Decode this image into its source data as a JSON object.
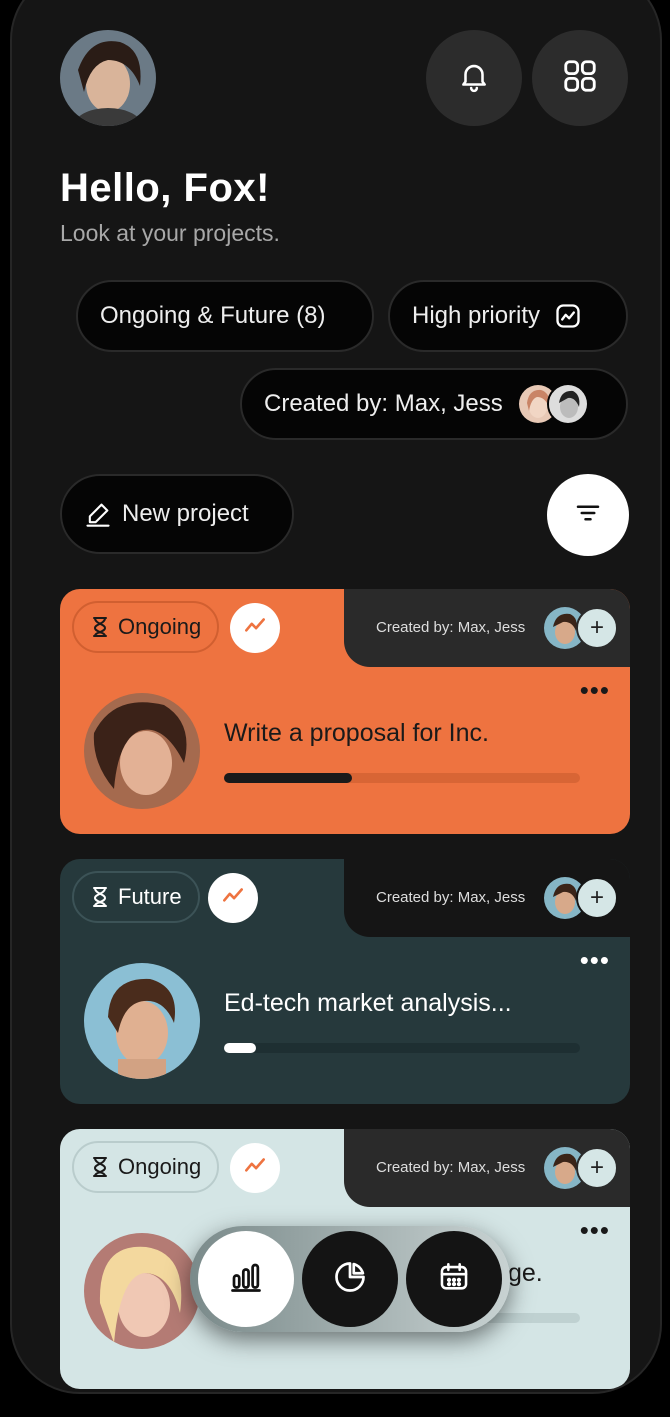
{
  "header": {
    "greeting": "Hello, Fox!",
    "subtitle": "Look at your projects.",
    "notification_icon": "bell-icon",
    "apps_icon": "grid-icon"
  },
  "filters": {
    "ongoing_future": "Ongoing & Future (8)",
    "high_priority": "High priority",
    "created_by": "Created by: Max, Jess"
  },
  "actions": {
    "new_project": "New project",
    "filter_icon": "filter-icon"
  },
  "cards": [
    {
      "status": "Ongoing",
      "created_by": "Created by: Max, Jess",
      "title": "Write a proposal for Inc.",
      "progress": 0.36,
      "bg": "#EE7340",
      "track": "#D86535",
      "fill": "#1A1A1A",
      "text_color": "#1A1A1A"
    },
    {
      "status": "Future",
      "created_by": "Created by: Max, Jess",
      "title": "Ed-tech market analysis...",
      "progress": 0.09,
      "bg": "#26393C",
      "track": "#1E2F32",
      "fill": "#FFFFFF",
      "text_color": "#FFFFFF"
    },
    {
      "status": "Ongoing",
      "created_by": "Created by: Max, Jess",
      "title_visible": "ge.",
      "progress": 0.0,
      "bg": "#D4E5E5",
      "track": "#BFD1D1",
      "fill": "#1A1A1A",
      "text_color": "#1A1A1A"
    }
  ],
  "colors": {
    "accent_orange": "#EE7340",
    "background": "#151515"
  }
}
